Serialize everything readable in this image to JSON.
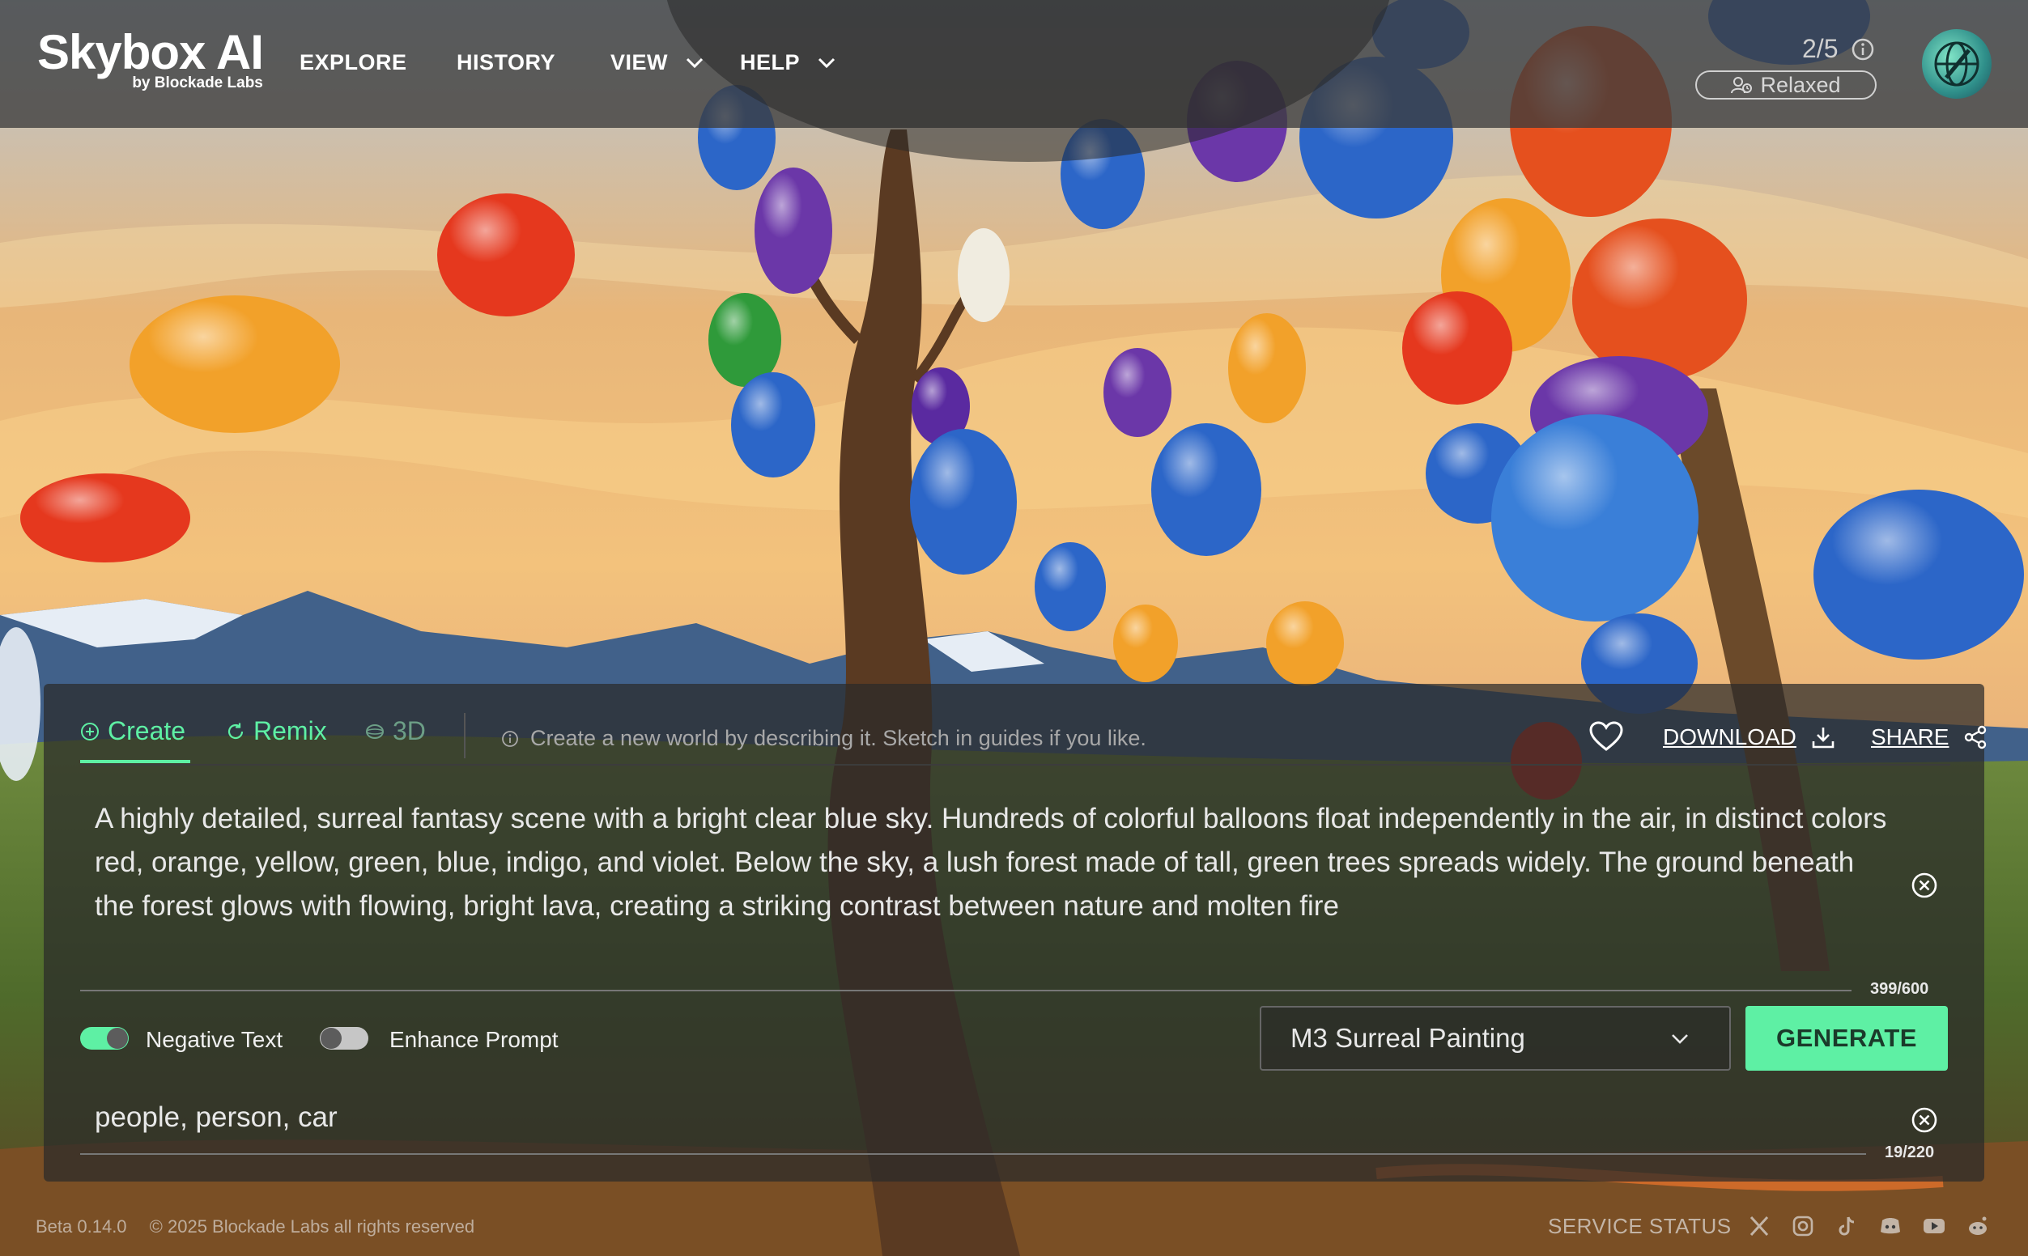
{
  "header": {
    "logo_title": "Skybox AI",
    "logo_sub": "by Blockade Labs",
    "nav": {
      "explore": "EXPLORE",
      "history": "HISTORY",
      "view": "VIEW",
      "help": "HELP"
    },
    "quota": "2/5",
    "mode": "Relaxed"
  },
  "tabs": {
    "create": "Create",
    "remix": "Remix",
    "three_d": "3D",
    "hint": "Create a new world by describing it. Sketch in guides if you like."
  },
  "actions": {
    "download": "DOWNLOAD",
    "share": "SHARE"
  },
  "prompt": {
    "text": "A highly detailed, surreal fantasy scene with a bright clear blue sky. Hundreds of colorful balloons float independently in the air, in distinct colors red, orange, yellow, green, blue, indigo, and violet. Below the sky, a lush forest made of tall, green trees spreads widely. The ground beneath the forest glows with flowing, bright lava, creating a striking contrast between nature and molten fire",
    "count": "399/600"
  },
  "options": {
    "negative_text_label": "Negative Text",
    "negative_text_on": true,
    "enhance_prompt_label": "Enhance Prompt",
    "enhance_prompt_on": false
  },
  "style_select": {
    "value": "M3 Surreal Painting"
  },
  "generate_label": "GENERATE",
  "negative": {
    "text": "people, person, car",
    "count": "19/220"
  },
  "footer": {
    "version": "Beta 0.14.0",
    "copyright": "© 2025 Blockade Labs all rights reserved",
    "service_status": "SERVICE STATUS"
  },
  "icons": {
    "info": "info-icon",
    "relaxed": "user-clock-icon",
    "create": "plus-circle-icon",
    "remix": "refresh-icon",
    "three_d": "cube-icon",
    "heart": "heart-icon",
    "download": "download-icon",
    "share": "share-icon",
    "clear": "close-circle-icon",
    "chevron": "chevron-down-icon",
    "socials": [
      "x-icon",
      "instagram-icon",
      "tiktok-icon",
      "discord-icon",
      "youtube-icon",
      "reddit-icon"
    ]
  },
  "colors": {
    "accent": "#5ef0a4",
    "header_bg": "#3c3c3c",
    "panel_bg": "#2a2a2a"
  }
}
